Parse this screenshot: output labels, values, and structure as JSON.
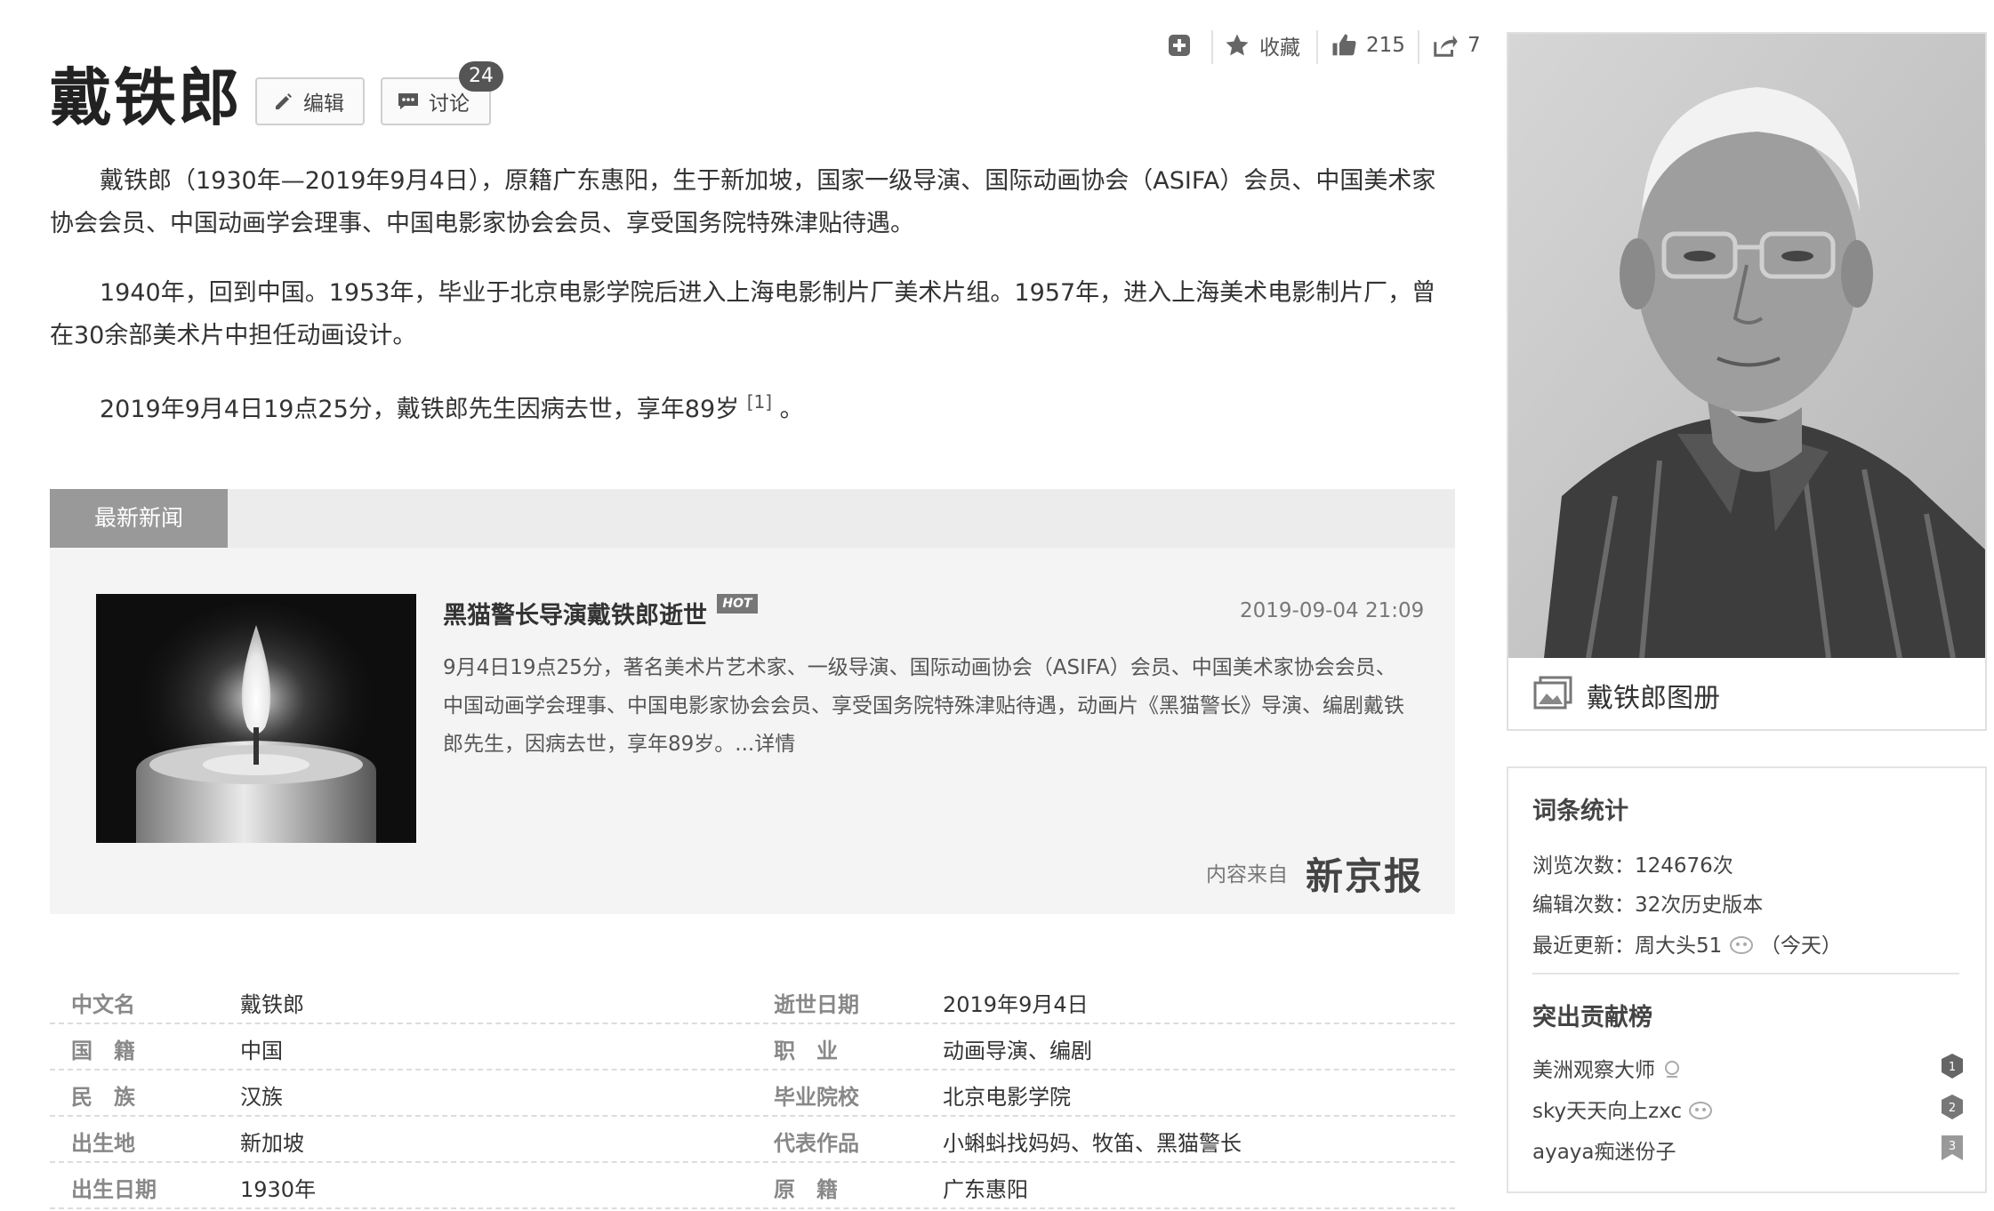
{
  "header": {
    "title": "戴铁郎",
    "edit_label": "编辑",
    "discuss_label": "讨论",
    "discuss_count": "24"
  },
  "toolbar": {
    "add_icon": "plus-square-icon",
    "favorite_label": "收藏",
    "like_count": "215",
    "share_count": "7"
  },
  "summary": {
    "p1": "戴铁郎（1930年—2019年9月4日），原籍广东惠阳，生于新加坡，国家一级导演、国际动画协会（ASIFA）会员、中国美术家协会会员、中国动画学会理事、中国电影家协会会员、享受国务院特殊津贴待遇。",
    "p2": "1940年，回到中国。1953年，毕业于北京电影学院后进入上海电影制片厂美术片组。1957年，进入上海美术电影制片厂，曾在30余部美术片中担任动画设计。",
    "p3": "2019年9月4日19点25分，戴铁郎先生因病去世，享年89岁",
    "p3_ref": "[1]",
    "p3_end": "。"
  },
  "news": {
    "tab_label": "最新新闻",
    "title": "黑猫警长导演戴铁郎逝世",
    "hot_badge": "HOT",
    "date": "2019-09-04 21:09",
    "body": "9月4日19点25分，著名美术片艺术家、一级导演、国际动画协会（ASIFA）会员、中国美术家协会会员、中国动画学会理事、中国电影家协会会员、享受国务院特殊津贴待遇，动画片《黑猫警长》导演、编剧戴铁郎先生，因病去世，享年89岁。...详情",
    "source_label": "内容来自",
    "source_name": "新京报"
  },
  "infobox": {
    "left": [
      {
        "key": "中文名",
        "value": "戴铁郎"
      },
      {
        "key": "国　籍",
        "value": "中国"
      },
      {
        "key": "民　族",
        "value": "汉族"
      },
      {
        "key": "出生地",
        "value": "新加坡"
      },
      {
        "key": "出生日期",
        "value": "1930年"
      }
    ],
    "right": [
      {
        "key": "逝世日期",
        "value": "2019年9月4日"
      },
      {
        "key": "职　业",
        "value": "动画导演、编剧"
      },
      {
        "key": "毕业院校",
        "value": "北京电影学院"
      },
      {
        "key": "代表作品",
        "value": "小蝌蚪找妈妈、牧笛、黑猫警长"
      },
      {
        "key": "原　籍",
        "value": "广东惠阳"
      }
    ]
  },
  "sidebar": {
    "album_label": "戴铁郎图册",
    "stats_title": "词条统计",
    "views": "浏览次数：124676次",
    "edits": "编辑次数：32次历史版本",
    "last_update_prefix": "最近更新：",
    "last_update_user": "周大头51",
    "last_update_when": "（今天）",
    "contrib_title": "突出贡献榜",
    "contributors": [
      "美洲观察大师",
      "sky天天向上zxc",
      "ayaya痴迷份子"
    ]
  }
}
